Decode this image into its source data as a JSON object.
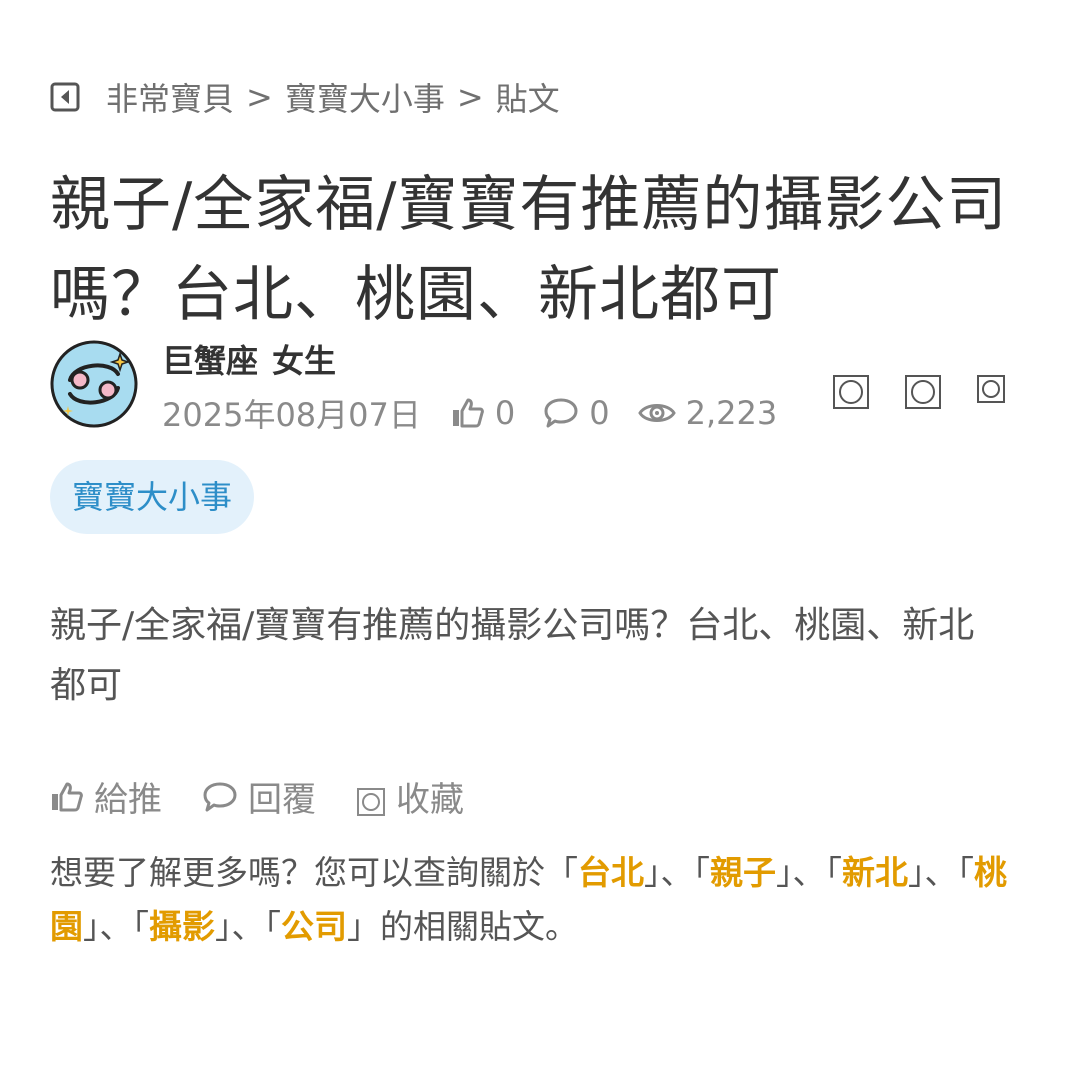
{
  "breadcrumb": {
    "items": [
      "非常寶貝",
      "寶寶大小事",
      "貼文"
    ],
    "separator": ">"
  },
  "post": {
    "title": "親子/全家福/寶寶有推薦的攝影公司嗎？台北、桃園、新北都可",
    "body": "親子/全家福/寶寶有推薦的攝影公司嗎？台北、桃園、新北都可",
    "tag": "寶寶大小事"
  },
  "author": {
    "sign": "巨蟹座",
    "gender": "女生",
    "avatar_icon": "cancer-zodiac-icon"
  },
  "meta": {
    "date": "2025年08月07日",
    "likes": "0",
    "comments": "0",
    "views": "2,223"
  },
  "actions": {
    "like_label": "給推",
    "reply_label": "回覆",
    "save_label": "收藏"
  },
  "related": {
    "prefix": "想要了解更多嗎？您可以查詢關於",
    "keywords": [
      "台北",
      "親子",
      "新北",
      "桃園",
      "攝影",
      "公司"
    ],
    "suffix": "的相關貼文。",
    "open_quote": "「",
    "close_quote": "」",
    "joiner": "、"
  },
  "colors": {
    "accent_keyword": "#e29b00",
    "tag_background": "#e3f1fb",
    "tag_text": "#2d8ec8"
  }
}
